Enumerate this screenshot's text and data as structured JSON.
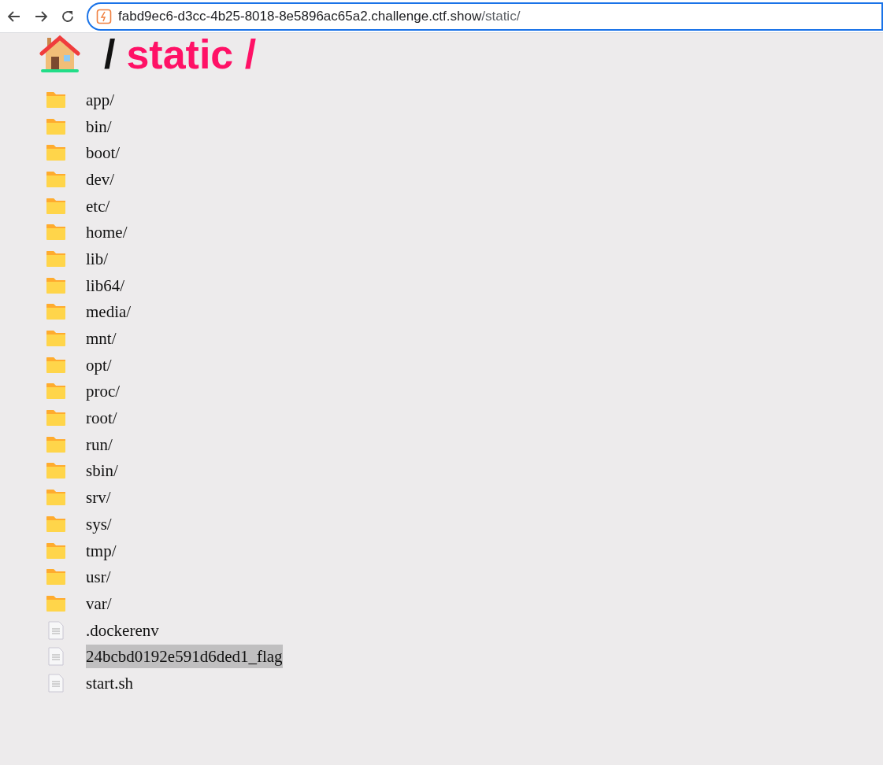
{
  "toolbar": {
    "url_host": "fabd9ec6-d3cc-4b25-8018-8e5896ac65a2.challenge.ctf.show",
    "url_path": "/static/"
  },
  "heading": {
    "root_separator": "/",
    "current": "static /"
  },
  "entries": [
    {
      "kind": "folder",
      "name": "app/",
      "selected": false
    },
    {
      "kind": "folder",
      "name": "bin/",
      "selected": false
    },
    {
      "kind": "folder",
      "name": "boot/",
      "selected": false
    },
    {
      "kind": "folder",
      "name": "dev/",
      "selected": false
    },
    {
      "kind": "folder",
      "name": "etc/",
      "selected": false
    },
    {
      "kind": "folder",
      "name": "home/",
      "selected": false
    },
    {
      "kind": "folder",
      "name": "lib/",
      "selected": false
    },
    {
      "kind": "folder",
      "name": "lib64/",
      "selected": false
    },
    {
      "kind": "folder",
      "name": "media/",
      "selected": false
    },
    {
      "kind": "folder",
      "name": "mnt/",
      "selected": false
    },
    {
      "kind": "folder",
      "name": "opt/",
      "selected": false
    },
    {
      "kind": "folder",
      "name": "proc/",
      "selected": false
    },
    {
      "kind": "folder",
      "name": "root/",
      "selected": false
    },
    {
      "kind": "folder",
      "name": "run/",
      "selected": false
    },
    {
      "kind": "folder",
      "name": "sbin/",
      "selected": false
    },
    {
      "kind": "folder",
      "name": "srv/",
      "selected": false
    },
    {
      "kind": "folder",
      "name": "sys/",
      "selected": false
    },
    {
      "kind": "folder",
      "name": "tmp/",
      "selected": false
    },
    {
      "kind": "folder",
      "name": "usr/",
      "selected": false
    },
    {
      "kind": "folder",
      "name": "var/",
      "selected": false
    },
    {
      "kind": "file",
      "name": ".dockerenv",
      "selected": false
    },
    {
      "kind": "file",
      "name": "24bcbd0192e591d6ded1_flag",
      "selected": true
    },
    {
      "kind": "file",
      "name": "start.sh",
      "selected": false
    }
  ]
}
